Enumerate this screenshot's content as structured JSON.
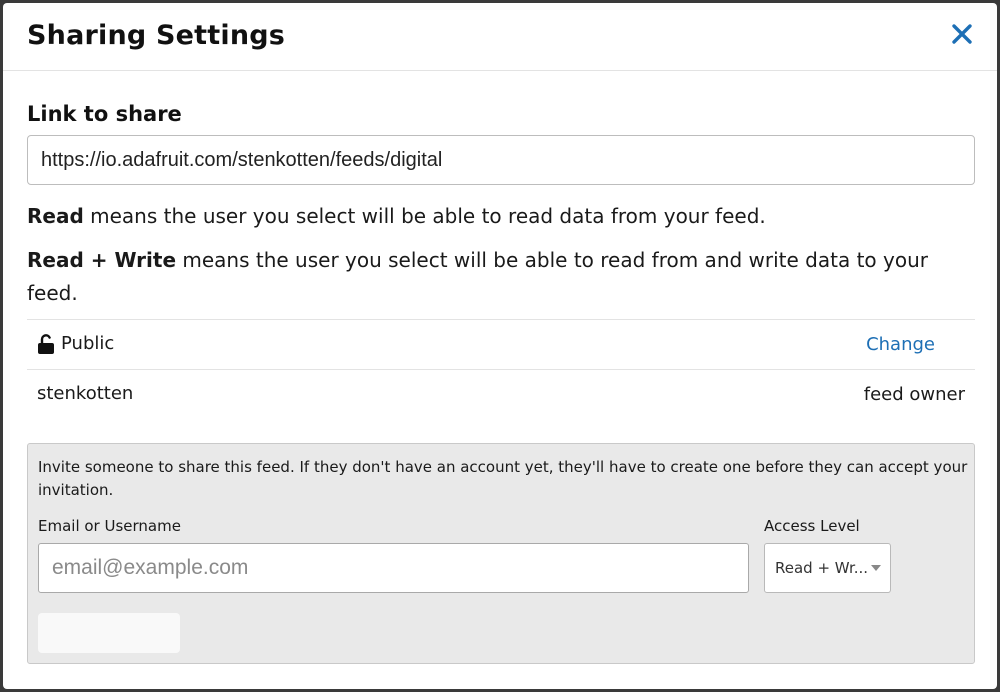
{
  "modal": {
    "title": "Sharing Settings",
    "close_icon": "close-icon"
  },
  "link": {
    "label": "Link to share",
    "value": "https://io.adafruit.com/stenkotten/feeds/digital"
  },
  "descriptions": {
    "read_term": "Read",
    "read_text": " means the user you select will be able to read data from your feed.",
    "rw_term": "Read + Write",
    "rw_text": " means the user you select will be able to read from and write data to your feed."
  },
  "sharing": {
    "public": {
      "icon": "unlock-icon",
      "label": "Public",
      "action": "Change"
    },
    "owner": {
      "name": "stenkotten",
      "role": "feed owner"
    }
  },
  "invite": {
    "text": "Invite someone to share this feed. If they don't have an account yet, they'll have to create one before they can accept your invitation.",
    "email_label": "Email or Username",
    "email_placeholder": "email@example.com",
    "access_label": "Access Level",
    "access_value": "Read + Wr...",
    "submit_label": ""
  },
  "colors": {
    "accent": "#1d6fb5",
    "panel_bg": "#e9e9e9"
  }
}
